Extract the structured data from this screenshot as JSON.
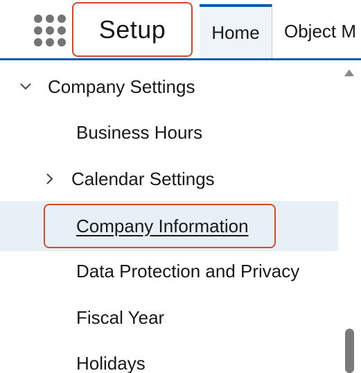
{
  "header": {
    "app_name": "Setup",
    "tabs": [
      {
        "label": "Home"
      },
      {
        "label": "Object M"
      }
    ]
  },
  "icons": {
    "app_launcher": "app-launcher-grid-icon",
    "expanded": "chevron-down-icon",
    "collapsed": "chevron-right-icon",
    "scroll_up": "scroll-up-arrow-icon"
  },
  "tree": {
    "items": [
      {
        "label": "Company Settings",
        "state": "expanded"
      },
      {
        "label": "Business Hours"
      },
      {
        "label": "Calendar Settings",
        "state": "collapsed"
      },
      {
        "label": "Company Information",
        "selected": true
      },
      {
        "label": "Data Protection and Privacy"
      },
      {
        "label": "Fiscal Year"
      },
      {
        "label": "Holidays"
      }
    ]
  },
  "colors": {
    "accent": "#0b5cab",
    "highlight_box": "#d9472b",
    "selected_row_bg": "#e8f0f7",
    "active_tab_bg": "#eef4f7"
  }
}
